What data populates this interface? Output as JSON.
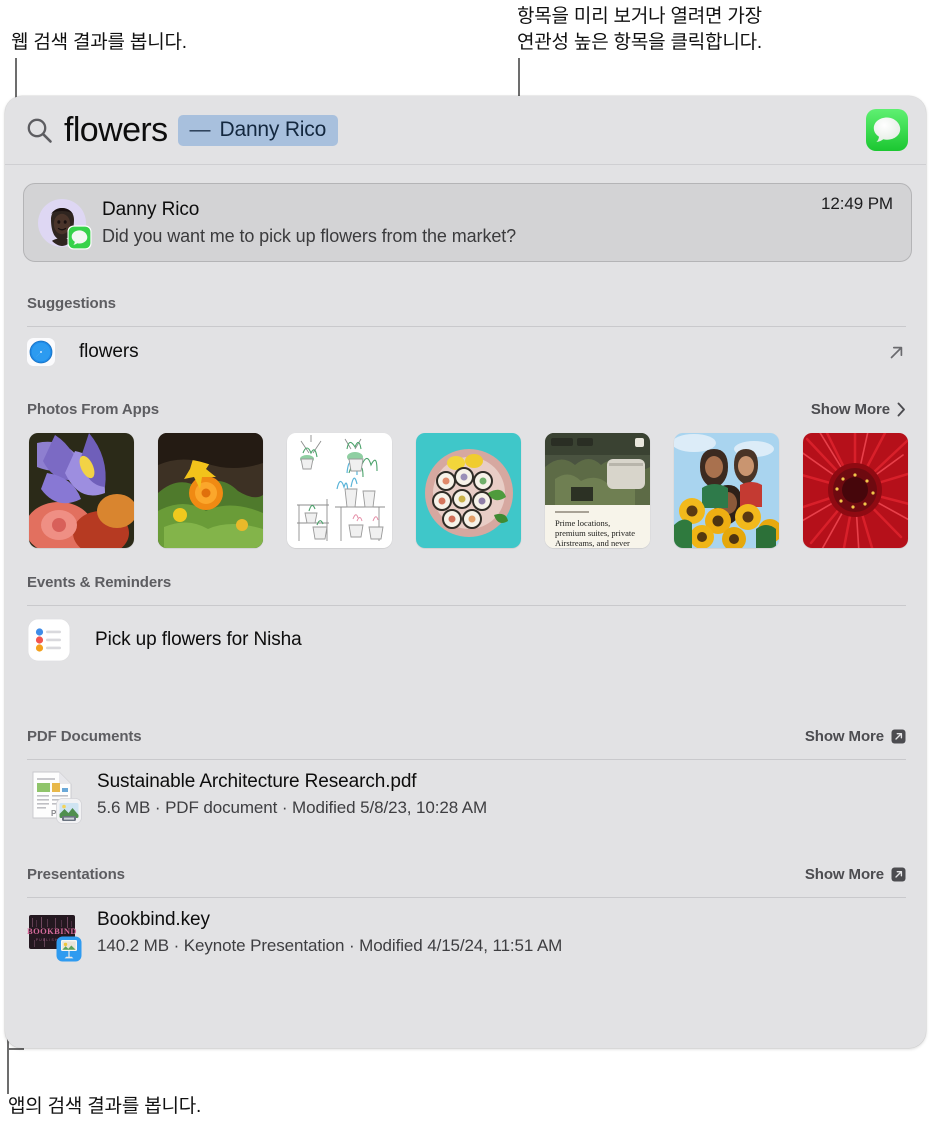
{
  "callouts": {
    "top_left": "웹 검색 결과를 봅니다.",
    "top_right": "항목을 미리 보거나 열려면 가장\n연관성 높은 항목을 클릭합니다.",
    "bottom_left": "앱의 검색 결과를 봅니다."
  },
  "search": {
    "icon": "search-icon",
    "query": "flowers",
    "token_dash": "—",
    "token_name": "Danny Rico",
    "app_badge": "messages-app-icon"
  },
  "top_result": {
    "avatar": "memoji-avatar",
    "app_badge": "messages-badge-icon",
    "title": "Danny Rico",
    "subtitle": "Did you want me to pick up flowers from the market?",
    "time": "12:49 PM"
  },
  "sections": [
    {
      "title": "Suggestions",
      "show_more": null,
      "rows": [
        {
          "icon": "safari-icon",
          "label": "flowers",
          "trailing_icon": "external-link-arrow-icon"
        }
      ]
    },
    {
      "title": "Photos From Apps",
      "show_more": {
        "label": "Show More",
        "icon": "chevron-right-icon"
      },
      "photos": [
        {
          "name": "purple-iris-bouquet-photo"
        },
        {
          "name": "orange-marigold-garden-photo"
        },
        {
          "name": "illustrated-houseplants-photo"
        },
        {
          "name": "sushi-platter-photo"
        },
        {
          "name": "airstream-listing-screenshot",
          "caption": "Prime locations,\npremium suites, private\nAirstreams, and never"
        },
        {
          "name": "friends-with-sunflowers-photo"
        },
        {
          "name": "red-gerbera-daisy-photo"
        }
      ]
    },
    {
      "title": "Events & Reminders",
      "show_more": null,
      "rows": [
        {
          "icon": "reminders-app-icon",
          "label": "Pick up flowers for Nisha"
        }
      ]
    },
    {
      "title": "PDF Documents",
      "show_more": {
        "label": "Show More",
        "icon": "open-in-new-box-icon"
      },
      "files": [
        {
          "icon": "pdf-document-icon",
          "badge": "preview-app-icon",
          "name": "Sustainable Architecture Research.pdf",
          "meta": "5.6 MB · PDF document · Modified 5/8/23, 10:28 AM"
        }
      ]
    },
    {
      "title": "Presentations",
      "show_more": {
        "label": "Show More",
        "icon": "open-in-new-box-icon"
      },
      "files": [
        {
          "icon": "bookbind-keynote-thumbnail",
          "badge": "keynote-app-icon",
          "name": "Bookbind.key",
          "meta": "140.2 MB · Keynote Presentation · Modified 4/15/24, 11:51 AM"
        }
      ]
    }
  ],
  "colors": {
    "panel_bg": "#e2e2e4",
    "card_bg": "#d3d3d5",
    "token_bg": "#a8c0dd",
    "messages_green": "#3bd24b",
    "section_header": "#5d5d61"
  }
}
